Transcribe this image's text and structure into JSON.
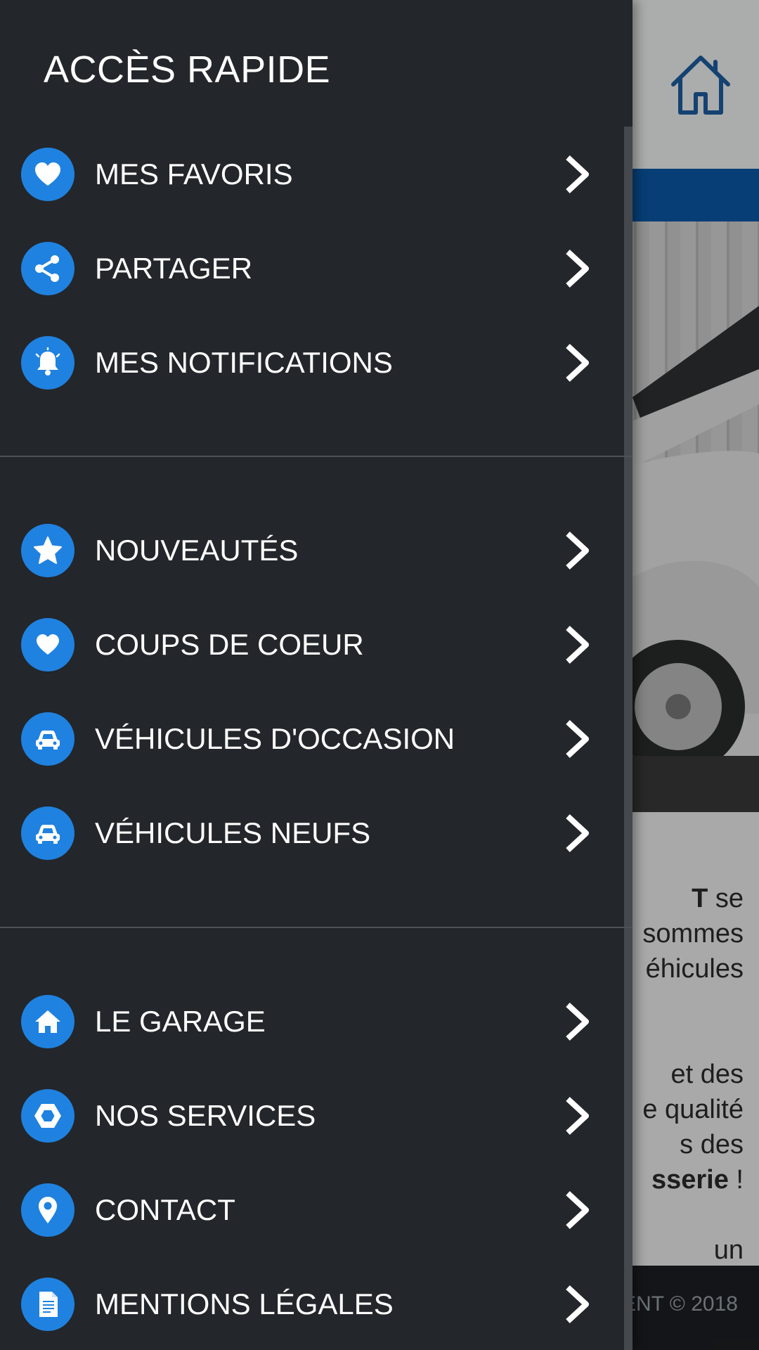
{
  "drawer": {
    "title": "ACCÈS RAPIDE",
    "sections": [
      {
        "items": [
          {
            "label": "MES FAVORIS",
            "icon": "heart-icon"
          },
          {
            "label": "PARTAGER",
            "icon": "share-icon"
          },
          {
            "label": "MES NOTIFICATIONS",
            "icon": "bell-icon"
          }
        ]
      },
      {
        "items": [
          {
            "label": "NOUVEAUTÉS",
            "icon": "star-icon"
          },
          {
            "label": "COUPS DE COEUR",
            "icon": "heart-icon"
          },
          {
            "label": "VÉHICULES D'OCCASION",
            "icon": "car-icon"
          },
          {
            "label": "VÉHICULES NEUFS",
            "icon": "car-icon"
          }
        ]
      },
      {
        "items": [
          {
            "label": "LE GARAGE",
            "icon": "house-icon"
          },
          {
            "label": "NOS SERVICES",
            "icon": "hexagon-icon"
          },
          {
            "label": "CONTACT",
            "icon": "location-pin-icon"
          },
          {
            "label": "MENTIONS LÉGALES",
            "icon": "document-icon"
          }
        ]
      }
    ]
  },
  "background": {
    "text_lines": [
      {
        "bold": "T",
        "rest": " se"
      },
      {
        "bold": "",
        "rest": "sommes"
      },
      {
        "bold": "",
        "rest": "éhicules"
      },
      {
        "bold": "",
        "rest": " et des"
      },
      {
        "bold": "",
        "rest": "e qualité"
      },
      {
        "bold": "",
        "rest": "s des"
      },
      {
        "bold": "sserie",
        "rest": " !"
      },
      {
        "bold": "",
        "rest": "un"
      }
    ],
    "footer": "ENT © 2018"
  },
  "colors": {
    "drawer_bg": "#23262a",
    "icon_bg": "#1f82e0",
    "brand_blue": "#0a5aa8"
  }
}
